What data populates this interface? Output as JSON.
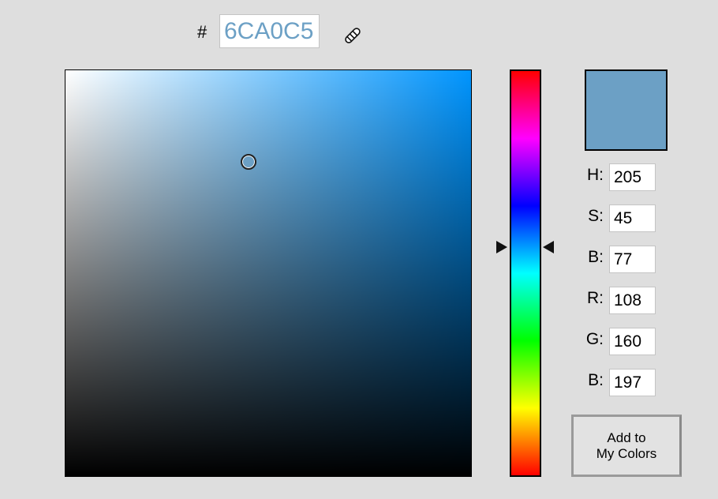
{
  "hex": {
    "prefix": "#",
    "value": "6CA0C5"
  },
  "color": {
    "hex": "#6ca0c5",
    "hue_color": "#0095ff"
  },
  "fields": [
    {
      "label": "H:",
      "value": "205"
    },
    {
      "label": "S:",
      "value": "45"
    },
    {
      "label": "B:",
      "value": "77"
    },
    {
      "label": "R:",
      "value": "108"
    },
    {
      "label": "G:",
      "value": "160"
    },
    {
      "label": "B:",
      "value": "197"
    }
  ],
  "add_button": {
    "line1": "Add to",
    "line2": "My Colors"
  },
  "icons": {
    "eyedropper": "eyedropper-icon"
  }
}
